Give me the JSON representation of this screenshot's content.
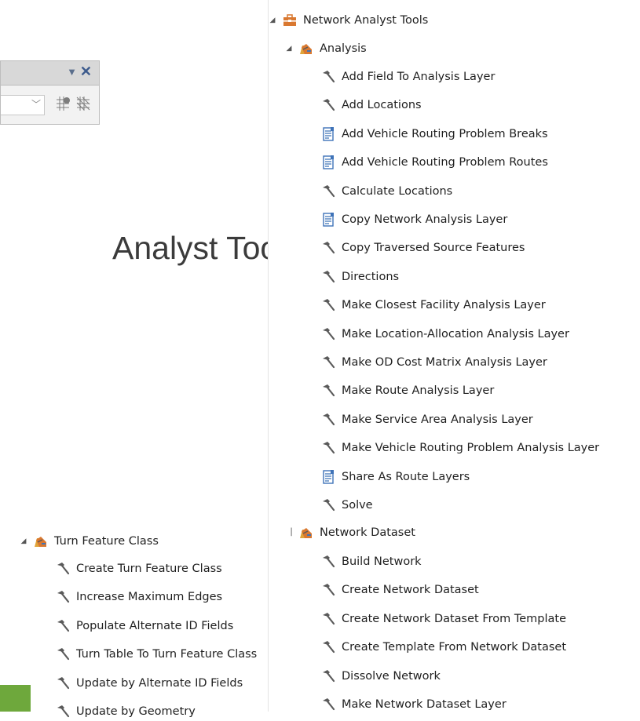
{
  "background_title": "Analyst Tools",
  "tree": {
    "root": "Network Analyst Tools",
    "analysis": {
      "label": "Analysis",
      "tools": [
        {
          "label": "Add Field To Analysis Layer",
          "icon": "hammer-icon"
        },
        {
          "label": "Add Locations",
          "icon": "hammer-icon"
        },
        {
          "label": "Add Vehicle Routing Problem Breaks",
          "icon": "script-icon"
        },
        {
          "label": "Add Vehicle Routing Problem Routes",
          "icon": "script-icon"
        },
        {
          "label": "Calculate Locations",
          "icon": "hammer-icon"
        },
        {
          "label": "Copy Network Analysis Layer",
          "icon": "script-icon"
        },
        {
          "label": "Copy Traversed Source Features",
          "icon": "hammer-icon"
        },
        {
          "label": "Directions",
          "icon": "hammer-icon"
        },
        {
          "label": "Make Closest Facility Analysis Layer",
          "icon": "hammer-icon"
        },
        {
          "label": "Make Location-Allocation Analysis Layer",
          "icon": "hammer-icon"
        },
        {
          "label": "Make OD Cost Matrix Analysis Layer",
          "icon": "hammer-icon"
        },
        {
          "label": "Make Route Analysis Layer",
          "icon": "hammer-icon"
        },
        {
          "label": "Make Service Area Analysis Layer",
          "icon": "hammer-icon"
        },
        {
          "label": "Make Vehicle Routing Problem Analysis Layer",
          "icon": "hammer-icon"
        },
        {
          "label": "Share As Route Layers",
          "icon": "script-icon"
        },
        {
          "label": "Solve",
          "icon": "hammer-icon"
        }
      ]
    },
    "network_dataset": {
      "label": "Network Dataset",
      "tools": [
        {
          "label": "Build Network",
          "icon": "hammer-icon"
        },
        {
          "label": "Create Network Dataset",
          "icon": "hammer-icon"
        },
        {
          "label": "Create Network Dataset From Template",
          "icon": "hammer-icon"
        },
        {
          "label": "Create Template From Network Dataset",
          "icon": "hammer-icon"
        },
        {
          "label": "Dissolve Network",
          "icon": "hammer-icon"
        },
        {
          "label": "Make Network Dataset Layer",
          "icon": "hammer-icon"
        }
      ]
    },
    "turn_feature_class": {
      "label": "Turn Feature Class",
      "tools": [
        {
          "label": "Create Turn Feature Class",
          "icon": "hammer-icon"
        },
        {
          "label": "Increase Maximum Edges",
          "icon": "hammer-icon"
        },
        {
          "label": "Populate Alternate ID Fields",
          "icon": "hammer-icon"
        },
        {
          "label": "Turn Table To Turn Feature Class",
          "icon": "hammer-icon"
        },
        {
          "label": "Update by Alternate ID Fields",
          "icon": "hammer-icon"
        },
        {
          "label": "Update by Geometry",
          "icon": "hammer-icon"
        }
      ]
    }
  },
  "colors": {
    "hammer": "#5a5a5a",
    "script": "#3f73b8",
    "toolbox": "#d97830",
    "accent_green": "#6ea83c"
  }
}
